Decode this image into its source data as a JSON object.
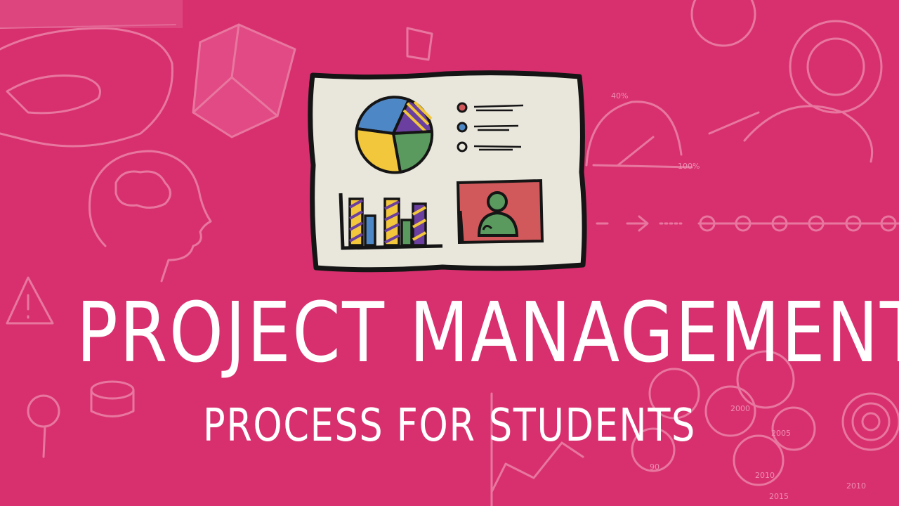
{
  "title": "PROJECT MANAGEMENT",
  "subtitle": "PROCESS FOR STUDENTS",
  "colors": {
    "background": "#d8306f",
    "text": "#ffffff",
    "board_fill": "#e9e6dc",
    "doodle_line": "#e8779f",
    "pie_blue": "#4e87c6",
    "pie_green": "#5a9a5e",
    "pie_yellow": "#f2c73c",
    "bar_purple": "#6a3fa0",
    "photo_red": "#d2595b"
  },
  "doodle_labels": [
    "40%",
    "100%",
    "2000",
    "2005",
    "2010",
    "2015",
    "2010",
    "90"
  ],
  "icons": [
    "baseball-field-icon",
    "cube-box-icon",
    "head-brain-icon",
    "warning-icon",
    "magnifier-icon",
    "gauge-icon",
    "speedometer-icon",
    "arrow-right-icon",
    "timeline-icon",
    "target-icon",
    "venn-diagram-icon",
    "presentation-board-icon"
  ]
}
